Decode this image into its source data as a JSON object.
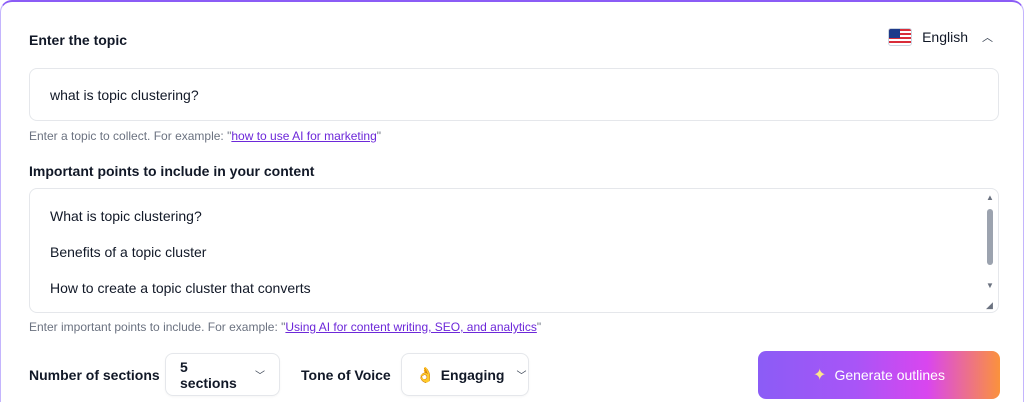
{
  "topic": {
    "heading": "Enter the topic",
    "value": "what is topic clustering?",
    "hint_prefix": "Enter a topic to collect. For example: \"",
    "hint_link": "how to use AI for marketing",
    "hint_suffix": "\""
  },
  "language": {
    "label": "English",
    "flag_icon": "us-flag-icon",
    "chevron_icon": "chevron-up-icon"
  },
  "points": {
    "heading": "Important points to include in your content",
    "items": [
      "What is topic clustering?",
      "Benefits of a topic cluster",
      "How to create a topic cluster that converts"
    ],
    "hint_prefix": "Enter important points to include. For example: \"",
    "hint_link": "Using AI for content writing, SEO, and analytics",
    "hint_suffix": "\""
  },
  "controls": {
    "sections_label": "Number of sections",
    "sections_value": "5 sections",
    "tone_label": "Tone of Voice",
    "tone_emoji": "👌",
    "tone_value": "Engaging",
    "generate_label": "Generate outlines",
    "generate_icon": "sparkle-icon"
  },
  "colors": {
    "accent": "#8b5cf6",
    "link": "#6d28d9",
    "button_gradient_start": "#8b5cf6",
    "button_gradient_end": "#fb923c"
  }
}
